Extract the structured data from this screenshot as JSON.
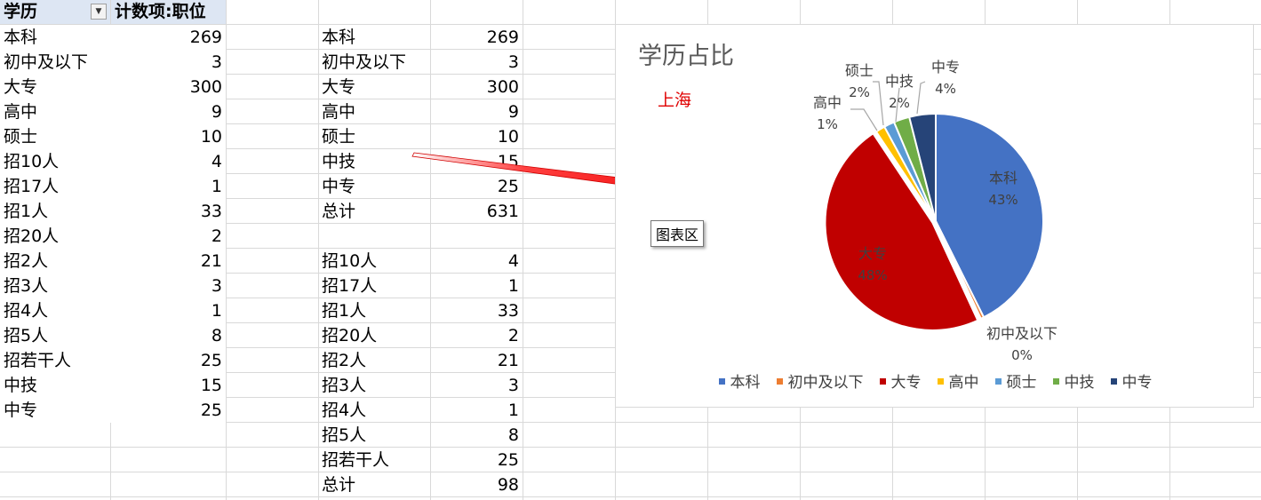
{
  "pivot": {
    "header_field": "学历",
    "header_value": "计数项:职位",
    "rows": [
      [
        "本科",
        "269"
      ],
      [
        "初中及以下",
        "3"
      ],
      [
        "大专",
        "300"
      ],
      [
        "高中",
        "9"
      ],
      [
        "硕士",
        "10"
      ],
      [
        "招10人",
        "4"
      ],
      [
        "招17人",
        "1"
      ],
      [
        "招1人",
        "33"
      ],
      [
        "招20人",
        "2"
      ],
      [
        "招2人",
        "21"
      ],
      [
        "招3人",
        "3"
      ],
      [
        "招4人",
        "1"
      ],
      [
        "招5人",
        "8"
      ],
      [
        "招若干人",
        "25"
      ],
      [
        "中技",
        "15"
      ],
      [
        "中专",
        "25"
      ]
    ]
  },
  "table2": {
    "rows": [
      [
        "本科",
        "269"
      ],
      [
        "初中及以下",
        "3"
      ],
      [
        "大专",
        "300"
      ],
      [
        "高中",
        "9"
      ],
      [
        "硕士",
        "10"
      ],
      [
        "中技",
        "15"
      ],
      [
        "中专",
        "25"
      ],
      [
        "总计",
        "631"
      ],
      [
        "",
        ""
      ],
      [
        "招10人",
        "4"
      ],
      [
        "招17人",
        "1"
      ],
      [
        "招1人",
        "33"
      ],
      [
        "招20人",
        "2"
      ],
      [
        "招2人",
        "21"
      ],
      [
        "招3人",
        "3"
      ],
      [
        "招4人",
        "1"
      ],
      [
        "招5人",
        "8"
      ],
      [
        "招若干人",
        "25"
      ],
      [
        "总计",
        "98"
      ]
    ]
  },
  "chart_data": {
    "type": "pie",
    "title": "学历占比",
    "subtitle": "上海",
    "tooltip": "图表区",
    "categories": [
      "本科",
      "初中及以下",
      "大专",
      "高中",
      "硕士",
      "中技",
      "中专"
    ],
    "values": [
      269,
      3,
      300,
      9,
      10,
      15,
      25
    ],
    "percent_labels": [
      "43%",
      "0%",
      "48%",
      "1%",
      "2%",
      "2%",
      "4%"
    ],
    "colors": [
      "#4472c4",
      "#ed7d31",
      "#c00000",
      "#ffc000",
      "#5b9bd5",
      "#70ad47",
      "#264478"
    ],
    "legend_position": "bottom"
  }
}
